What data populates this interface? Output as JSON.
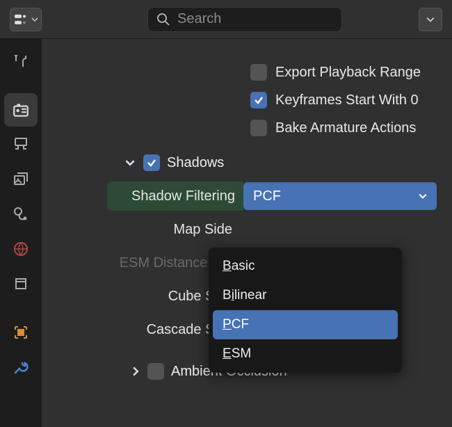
{
  "search": {
    "placeholder": "Search"
  },
  "checkboxes": {
    "export_playback": {
      "label": "Export Playback Range",
      "checked": false
    },
    "keyframes_start": {
      "label": "Keyframes Start With 0",
      "checked": true
    },
    "bake_armature": {
      "label": "Bake Armature Actions",
      "checked": false
    }
  },
  "section": {
    "shadows_label": "Shadows"
  },
  "fields": {
    "shadow_filtering": {
      "label": "Shadow Filtering",
      "value": "PCF"
    },
    "map_side": {
      "label": "Map Side"
    },
    "esm_distance": {
      "label": "ESM Distance S..."
    },
    "cube_size": {
      "label": "Cube Size"
    },
    "cascade_size": {
      "label": "Cascade Size"
    }
  },
  "dropdown": {
    "options": [
      "Basic",
      "Bilinear",
      "PCF",
      "ESM"
    ],
    "selected": "PCF"
  },
  "subsection": {
    "ambient_occlusion": "Ambient Occlusion"
  }
}
